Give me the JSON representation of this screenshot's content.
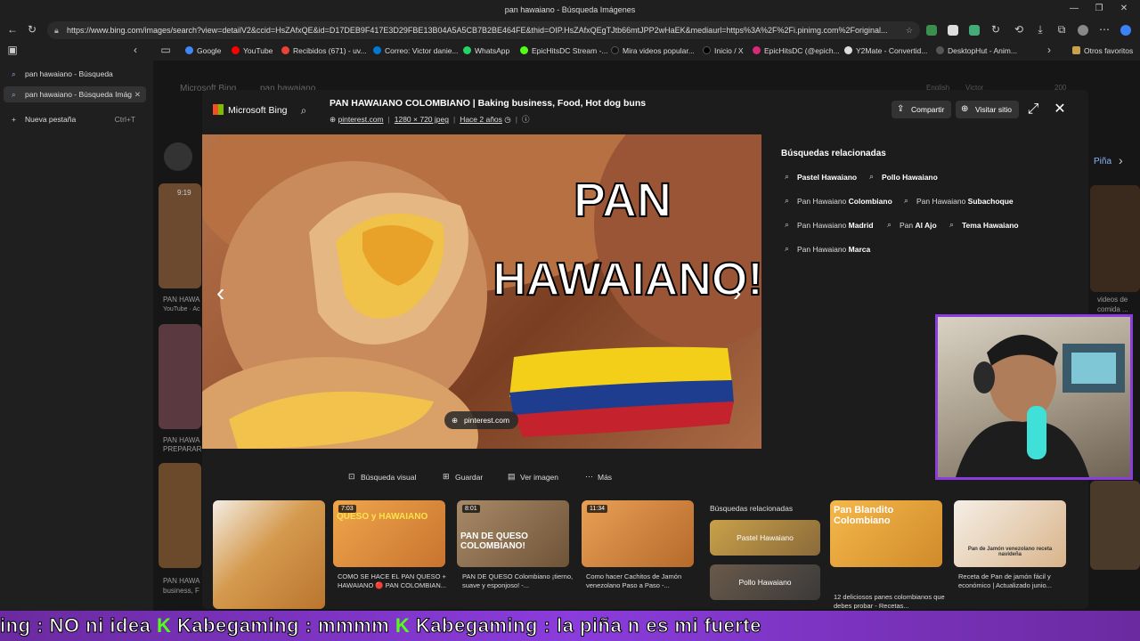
{
  "window": {
    "title": "pan hawaiano - Búsqueda Imágenes",
    "controls": [
      "—",
      "❐",
      "✕"
    ]
  },
  "toolbar": {
    "url": "https://www.bing.com/images/search?view=detailV2&ccid=HsZAfxQE&id=D17DEB9F417E3D29FBE13B04A5A5CB7B2BE464FE&thid=OIP.HsZAfxQEgTJtb66mtJPP2wHaEK&mediaurl=https%3A%2F%2Fi.pinimg.com%2Foriginal..."
  },
  "bookmarks": {
    "items": [
      {
        "label": "Google",
        "color": "#4285f4"
      },
      {
        "label": "YouTube",
        "color": "#ff0000"
      },
      {
        "label": "Recibidos (671) - uv...",
        "color": "#ea4335"
      },
      {
        "label": "Correo: Victor danie...",
        "color": "#0078d4"
      },
      {
        "label": "WhatsApp",
        "color": "#25d366"
      },
      {
        "label": "EpicHitsDC Stream -...",
        "color": "#53fc18"
      },
      {
        "label": "Mira videos popular...",
        "color": "#111111"
      },
      {
        "label": "Inicio / X",
        "color": "#000000"
      },
      {
        "label": "EpicHitsDC (@epich...",
        "color": "#d62976"
      },
      {
        "label": "Y2Mate - Convertid...",
        "color": "#dddddd"
      },
      {
        "label": "DesktopHut - Anim...",
        "color": "#333333"
      }
    ],
    "other": "Otros favoritos"
  },
  "sidebar": {
    "tabs": [
      {
        "label": "pan hawaiano - Búsqueda"
      },
      {
        "label": "pan hawaiano - Búsqueda Imág"
      }
    ],
    "new_tab": "Nueva pestaña",
    "new_tab_shortcut": "Ctrl+T"
  },
  "background": {
    "brand": "Microsoft Bing",
    "query": "pan hawaiano",
    "lang": "English",
    "user": "Victor",
    "points": "200",
    "right_label": "Piña",
    "left_captions": [
      "PAN HAWA",
      "YouTube · Ac",
      "PAN HAWA",
      "PREPARAR",
      "PAN HAWA",
      "business, F"
    ],
    "right_captions": [
      "videos de",
      "comida ..."
    ],
    "duration": "9:19"
  },
  "modal": {
    "brand": "Microsoft Bing",
    "title": "PAN HAWAIANO COLOMBIANO | Baking business, Food, Hot dog buns",
    "source": "pinterest.com",
    "dimensions": "1280 × 720 jpeg",
    "age": "Hace 2 años",
    "share": "Compartir",
    "visit": "Visitar sitio",
    "image_text_line1": "PAN",
    "image_text_line2": "HAWAIANO!",
    "image_source_pill": "pinterest.com",
    "related_heading": "Búsquedas relacionadas",
    "related": [
      {
        "normal": "",
        "bold": "Pastel Hawaiano"
      },
      {
        "normal": "",
        "bold": "Pollo Hawaiano"
      },
      {
        "normal": "Pan Hawaiano ",
        "bold": "Colombiano"
      },
      {
        "normal": "Pan Hawaiano ",
        "bold": "Subachoque"
      },
      {
        "normal": "Pan Hawaiano ",
        "bold": "Madrid"
      },
      {
        "normal": "Pan ",
        "bold": "Al Ajo"
      },
      {
        "normal": "",
        "bold": "Tema Hawaiano"
      },
      {
        "normal": "Pan Hawaiano ",
        "bold": "Marca"
      }
    ],
    "actions": {
      "visual_search": "Búsqueda visual",
      "save": "Guardar",
      "view_image": "Ver imagen",
      "more": "Más"
    },
    "thumbnails": [
      {
        "duration": "",
        "overlay": "",
        "caption": "",
        "color": "#c9873f"
      },
      {
        "duration": "7:03",
        "overlay": "QUESO y HAWAIANO",
        "caption": "COMO SE HACE EL PAN QUESO + HAWAIANO 🔴 PAN COLOMBIAN...",
        "color": "#d58a2c"
      },
      {
        "duration": "8:01",
        "overlay": "PAN DE QUESO COLOMBIANO!",
        "caption": "PAN DE QUESO Colombiano ¡tierno, suave y esponjoso! -...",
        "color": "#8a6a4a"
      },
      {
        "duration": "11:34",
        "overlay": "",
        "caption": "Como hacer Cachitos de Jamón venezolano Paso a Paso -...",
        "color": "#c97a35"
      }
    ],
    "related_box": {
      "heading": "Búsquedas relacionadas",
      "cards": [
        "Pastel Hawaiano",
        "Pollo Hawaiano"
      ]
    },
    "right_thumbs": [
      {
        "overlay": "Pan Blandito Colombiano",
        "caption": "12 deliciosos panes colombianos que debes probar - Recetas...",
        "color": "#e0a040"
      },
      {
        "overlay": "Pan de Jamón venezolano receta navideña",
        "caption": "Receta de Pan de jamón fácil y económico | Actualizado junio...",
        "color": "#f4efe6"
      }
    ]
  },
  "ticker": {
    "segments": [
      "ing : NO ni idea ",
      "Kabegaming",
      " : mmmm ",
      "Kabegaming",
      " : la piña n es mi fuerte"
    ]
  }
}
